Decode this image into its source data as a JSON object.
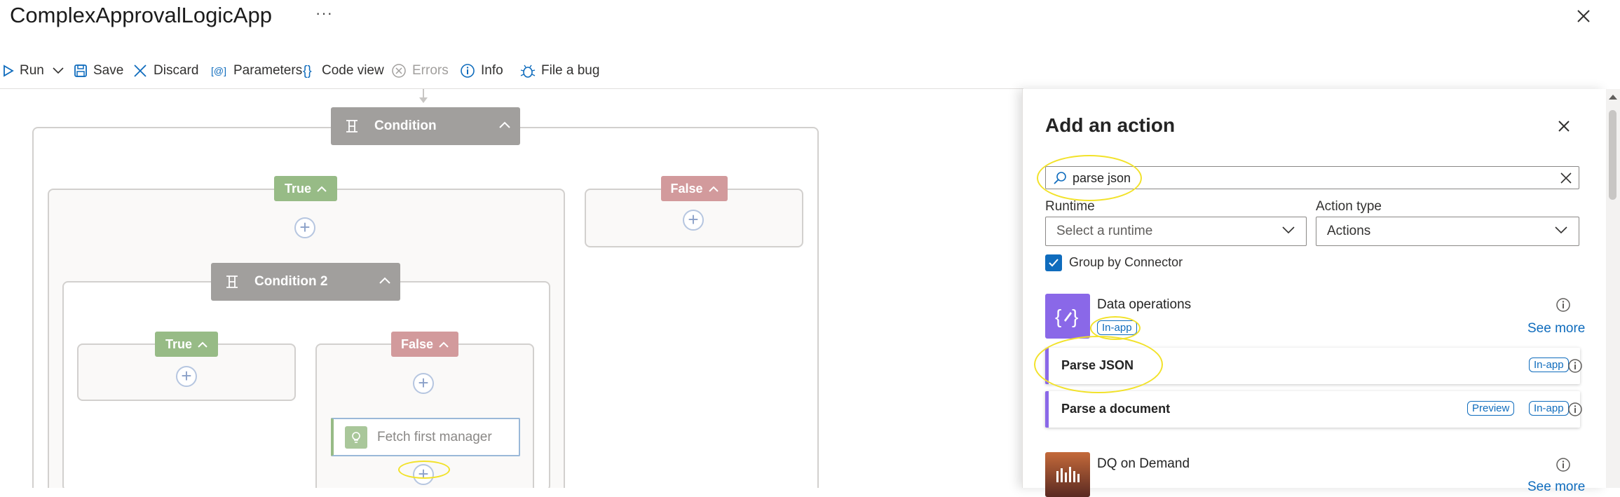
{
  "app": {
    "title": "ComplexApprovalLogicApp",
    "more_label": "···"
  },
  "toolbar": {
    "run": "Run",
    "save": "Save",
    "discard": "Discard",
    "parameters": "Parameters",
    "code_view": "Code view",
    "errors": "Errors",
    "info": "Info",
    "file_bug": "File a bug"
  },
  "canvas": {
    "condition_label": "Condition",
    "true_label": "True",
    "false_label": "False",
    "condition2_label": "Condition 2",
    "inner_true_label": "True",
    "inner_false_label": "False",
    "fetch_action_label": "Fetch first manager"
  },
  "panel": {
    "title": "Add an action",
    "search_value": "parse json",
    "runtime_label": "Runtime",
    "runtime_placeholder": "Select a runtime",
    "action_type_label": "Action type",
    "action_type_value": "Actions",
    "group_by_label": "Group by Connector",
    "group_by_checked": true,
    "connectors": [
      {
        "name": "Data operations",
        "badge": "In-app",
        "see_more": "See more",
        "icon": "braces-pencil-icon",
        "color": "#8a68e8"
      },
      {
        "name": "DQ on Demand",
        "see_more": "See more",
        "icon": "bars-icon",
        "color": "#8c4a33"
      }
    ],
    "actions": [
      {
        "label": "Parse JSON",
        "badges": [
          "In-app"
        ]
      },
      {
        "label": "Parse a document",
        "badges": [
          "Preview",
          "In-app"
        ]
      }
    ]
  },
  "colors": {
    "accent": "#0f6cbd",
    "true_branch": "#97bb86",
    "false_branch": "#d29a9c",
    "condition": "#a19f9d",
    "highlight": "#f2e22a"
  }
}
